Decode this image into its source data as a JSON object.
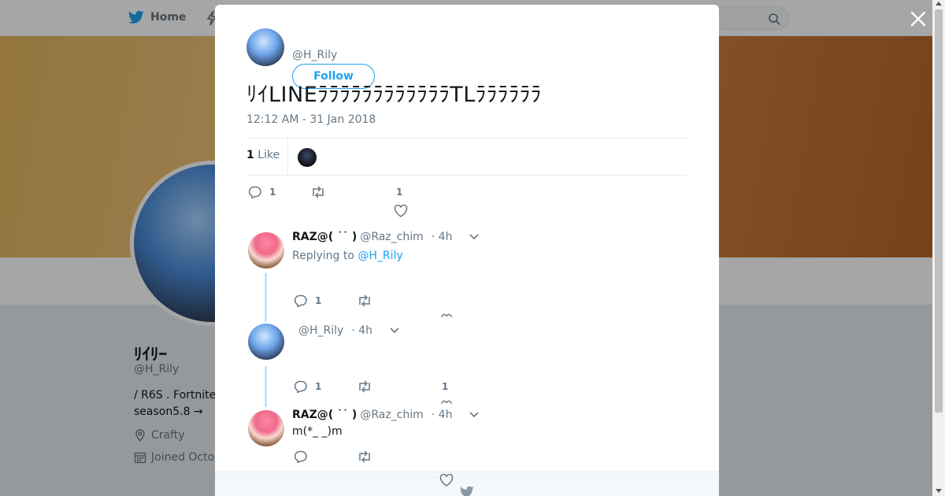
{
  "nav": {
    "home_label": "Home",
    "search_placeholder": ""
  },
  "profile": {
    "name": "ﾘｲﾘｰ",
    "handle": "@H_Rily",
    "bio_line1": " / R6S . Fortnite",
    "bio_line2": "season5.8 →",
    "location": "Crafty",
    "joined": "Joined Octo"
  },
  "tweet": {
    "handle": "@H_Rily",
    "follow_label": "Follow",
    "text": "ﾘｲLINEﾗﾗﾗﾗﾗﾗﾗﾗﾗﾗﾗﾗTLﾗﾗﾗﾗﾗﾗ",
    "time": "12:12 AM - 31 Jan 2018",
    "likes_count": "1",
    "likes_label": "Like",
    "reply_count": "1",
    "like_count_action": "1"
  },
  "replies": [
    {
      "name": "RAZ@( ˙˙ )",
      "handle": "@Raz_chim",
      "time": "· 4h",
      "replying_prefix": "Replying to",
      "replying_to": "@H_Rily",
      "text": "",
      "reply_count": "1"
    },
    {
      "name": "",
      "handle": "@H_Rily",
      "time": "· 4h",
      "text": "",
      "reply_count": "1",
      "like_count": "1"
    },
    {
      "name": "RAZ@( ˙˙ )",
      "handle": "@Raz_chim",
      "time": "· 4h",
      "text": "m(*_ _)m"
    }
  ],
  "colors": {
    "accent": "#1da1f2",
    "muted": "#657786",
    "thread_line": "#c4e4fb"
  }
}
